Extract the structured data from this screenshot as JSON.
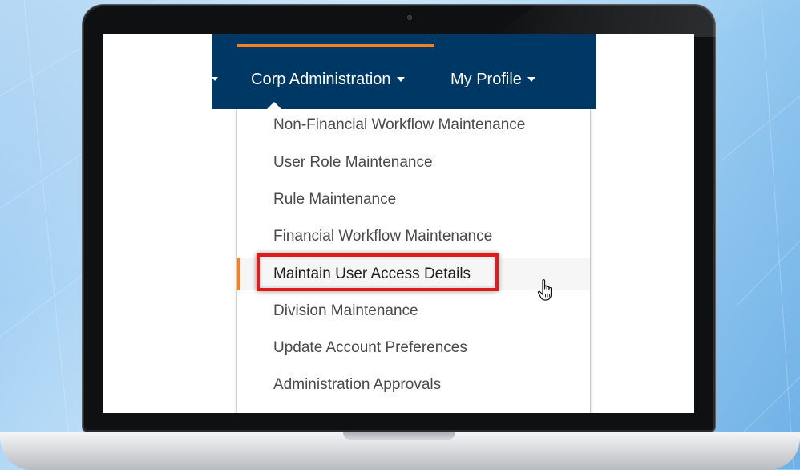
{
  "navbar": {
    "items": [
      {
        "label": "Corp Administration"
      },
      {
        "label": "My Profile"
      }
    ]
  },
  "dropdown": {
    "items": [
      {
        "label": "Non-Financial Workflow Maintenance"
      },
      {
        "label": "User Role Maintenance"
      },
      {
        "label": "Rule Maintenance"
      },
      {
        "label": "Financial Workflow Maintenance"
      },
      {
        "label": "Maintain User Access Details",
        "active": true
      },
      {
        "label": "Division Maintenance"
      },
      {
        "label": "Update Account Preferences"
      },
      {
        "label": "Administration Approvals"
      }
    ]
  },
  "colors": {
    "navbar": "#003865",
    "accent": "#f58220",
    "highlight": "#e01b1b"
  }
}
